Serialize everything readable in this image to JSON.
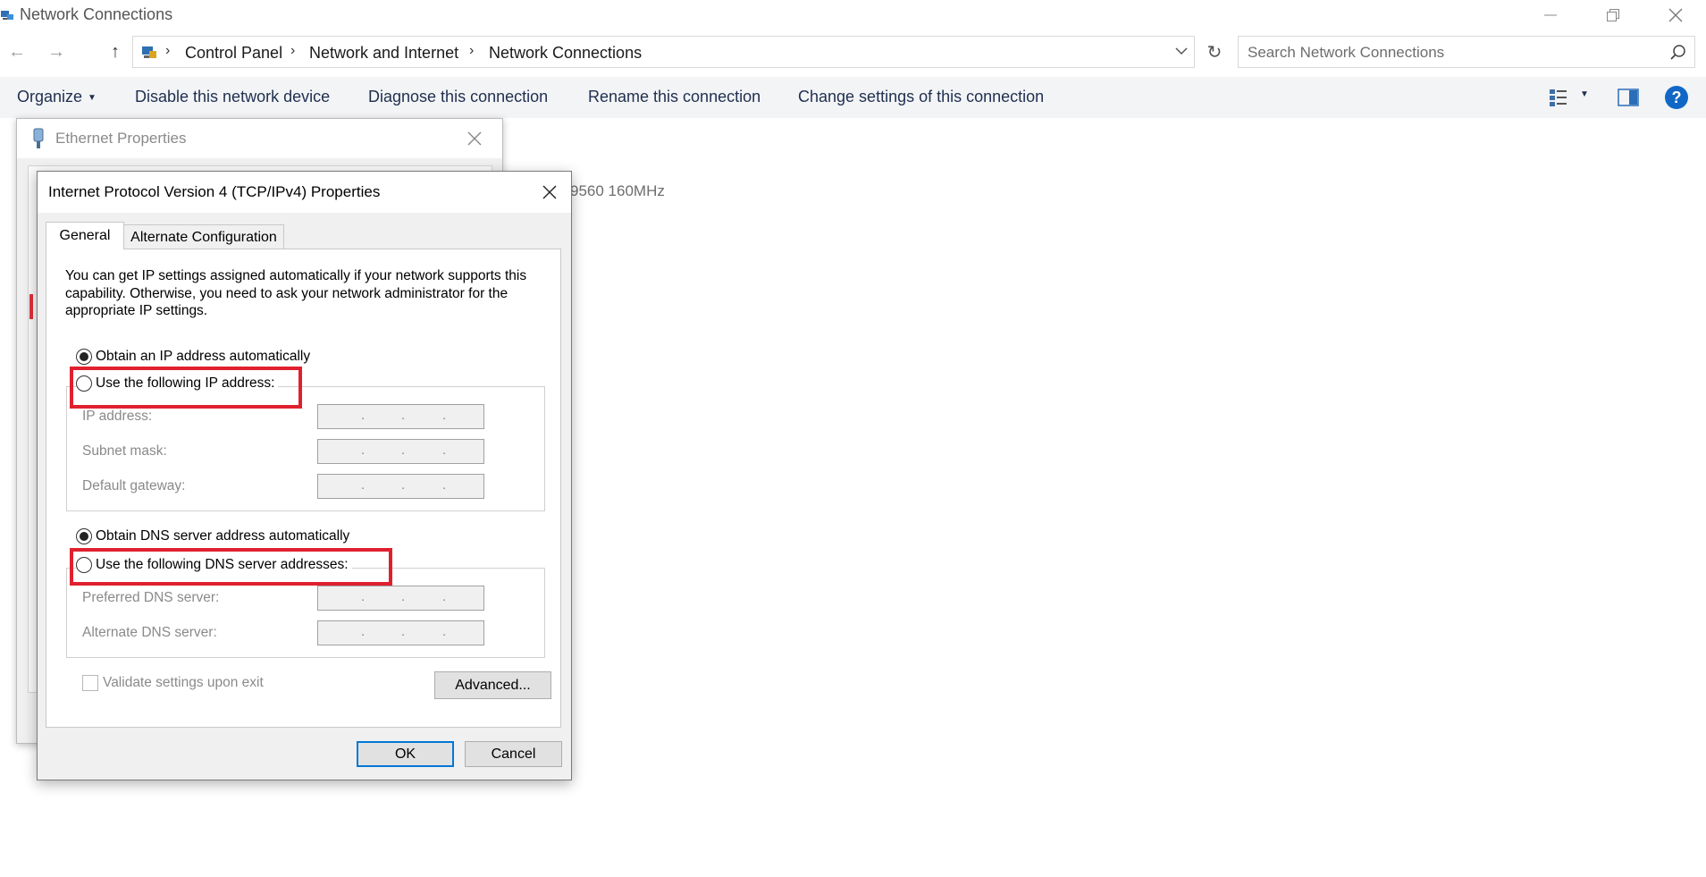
{
  "window": {
    "title": "Network Connections"
  },
  "address_bar": {
    "breadcrumbs": [
      "Control Panel",
      "Network and Internet",
      "Network Connections"
    ],
    "search_placeholder": "Search Network Connections"
  },
  "command_bar": {
    "organize": "Organize",
    "disable": "Disable this network device",
    "diagnose": "Diagnose this connection",
    "rename": "Rename this connection",
    "change_settings": "Change settings of this connection",
    "help": "?"
  },
  "background": {
    "adapter_text_fragment": "9560 160MHz"
  },
  "ethernet_dialog": {
    "title": "Ethernet Properties"
  },
  "ipv4_dialog": {
    "title": "Internet Protocol Version 4 (TCP/IPv4) Properties",
    "tabs": [
      "General",
      "Alternate Configuration"
    ],
    "intro": "You can get IP settings assigned automatically if your network supports this capability. Otherwise, you need to ask your network administrator for the appropriate IP settings.",
    "ip": {
      "auto_label": "Obtain an IP address automatically",
      "manual_label": "Use the following IP address:",
      "selected": "auto",
      "fields": [
        {
          "label": "IP address:",
          "value": ". . ."
        },
        {
          "label": "Subnet mask:",
          "value": ". . ."
        },
        {
          "label": "Default gateway:",
          "value": ". . ."
        }
      ]
    },
    "dns": {
      "auto_label": "Obtain DNS server address automatically",
      "manual_label": "Use the following DNS server addresses:",
      "selected": "auto",
      "fields": [
        {
          "label": "Preferred DNS server:",
          "value": ". . ."
        },
        {
          "label": "Alternate DNS server:",
          "value": ". . ."
        }
      ]
    },
    "validate_label": "Validate settings upon exit",
    "validate_checked": false,
    "advanced_label": "Advanced...",
    "ok_label": "OK",
    "cancel_label": "Cancel"
  },
  "colors": {
    "highlight": "#e0202e",
    "help_blue": "#1167c5",
    "command_bar_bg": "#f3f4f6",
    "default_button_border": "#0078d7"
  }
}
